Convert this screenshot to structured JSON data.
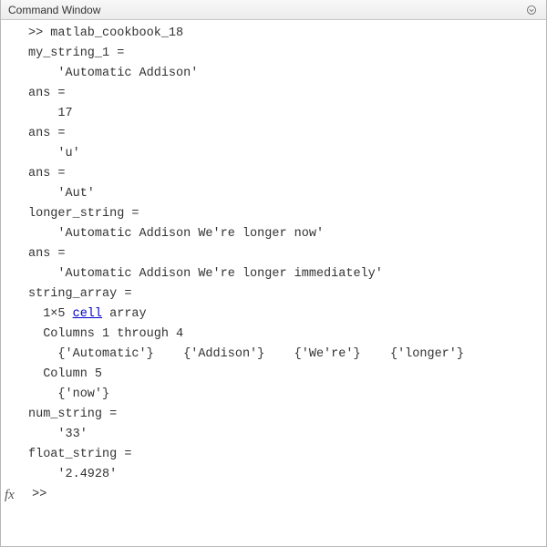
{
  "window": {
    "title": "Command Window",
    "dropdown_icon": "chevron-down-circle"
  },
  "lines": {
    "l0": ">> matlab_cookbook_18",
    "l1": "my_string_1 =",
    "l2": "    'Automatic Addison'",
    "l3": "ans =",
    "l4": "    17",
    "l5": "ans =",
    "l6": "    'u'",
    "l7": "ans =",
    "l8": "    'Aut'",
    "l9": "longer_string =",
    "l10": "    'Automatic Addison We're longer now'",
    "l11": "ans =",
    "l12": "    'Automatic Addison We're longer immediately'",
    "l13": "string_array =",
    "l14a": "  1×5 ",
    "l14b": "cell",
    "l14c": " array",
    "l15": "  Columns 1 through 4",
    "l16": "    {'Automatic'}    {'Addison'}    {'We're'}    {'longer'}",
    "l17": "  Column 5",
    "l18": "    {'now'}",
    "l19": "num_string =",
    "l20": "    '33'",
    "l21": "float_string =",
    "l22": "    '2.4928'"
  },
  "prompt": {
    "fx": "fx",
    "text": " >> "
  }
}
